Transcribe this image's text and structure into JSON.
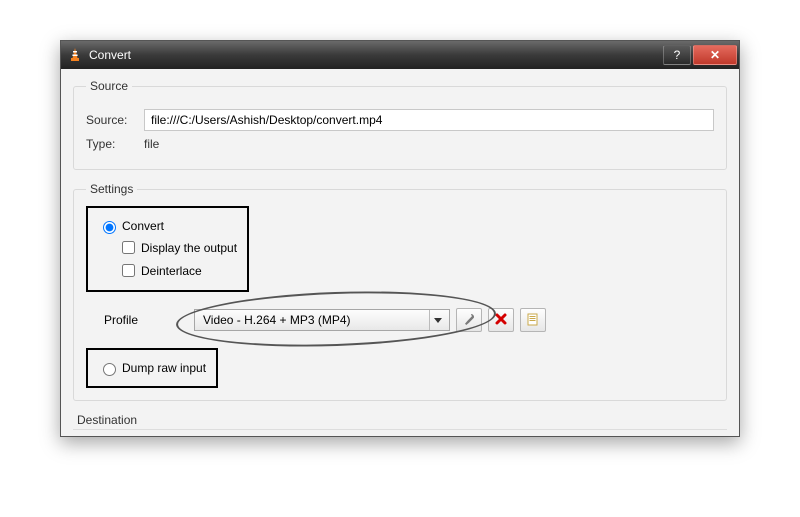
{
  "window": {
    "title": "Convert",
    "help": "?",
    "close": "✕"
  },
  "source_group": {
    "legend": "Source",
    "source_label": "Source:",
    "source_value": "file:///C:/Users/Ashish/Desktop/convert.mp4",
    "type_label": "Type:",
    "type_value": "file"
  },
  "settings_group": {
    "legend": "Settings",
    "convert_label": "Convert",
    "display_output_label": "Display the output",
    "deinterlace_label": "Deinterlace",
    "profile_label": "Profile",
    "profile_selected": "Video - H.264 + MP3 (MP4)",
    "dump_raw_label": "Dump raw input"
  },
  "destination_group": {
    "legend": "Destination"
  },
  "icons": {
    "wrench": "wrench-icon",
    "delete": "delete-icon",
    "new": "new-profile-icon"
  }
}
